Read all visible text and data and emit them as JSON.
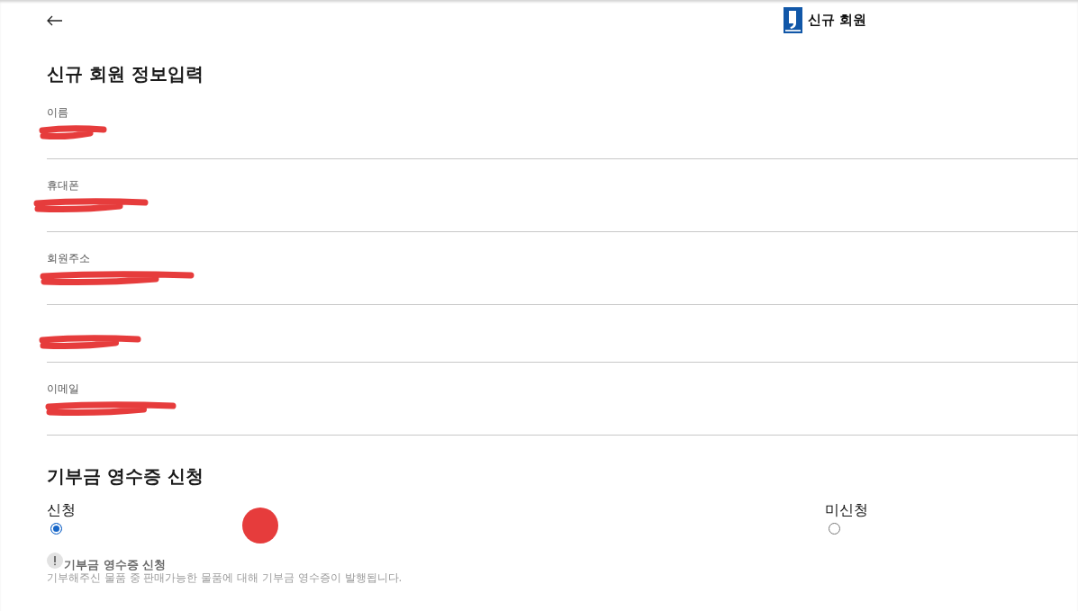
{
  "header": {
    "title": "신규 회원"
  },
  "form": {
    "heading": "신규 회원 정보입력",
    "fields": [
      {
        "label": "이름",
        "redacted": true
      },
      {
        "label": "휴대폰",
        "redacted": true
      },
      {
        "label": "회원주소",
        "redacted": true
      },
      {
        "redacted": true
      },
      {
        "label": "이메일",
        "redacted": true
      }
    ]
  },
  "receipt": {
    "heading": "기부금 영수증 신청",
    "options": [
      {
        "label": "신청",
        "selected": true
      },
      {
        "label": "미신청",
        "selected": false
      }
    ],
    "notice": {
      "title": "기부금 영수증 신청",
      "text": "기부해주신 물품 중 판매가능한 물품에 대해 기부금 영수증이 발행됩니다."
    }
  },
  "touch_indicator": true
}
